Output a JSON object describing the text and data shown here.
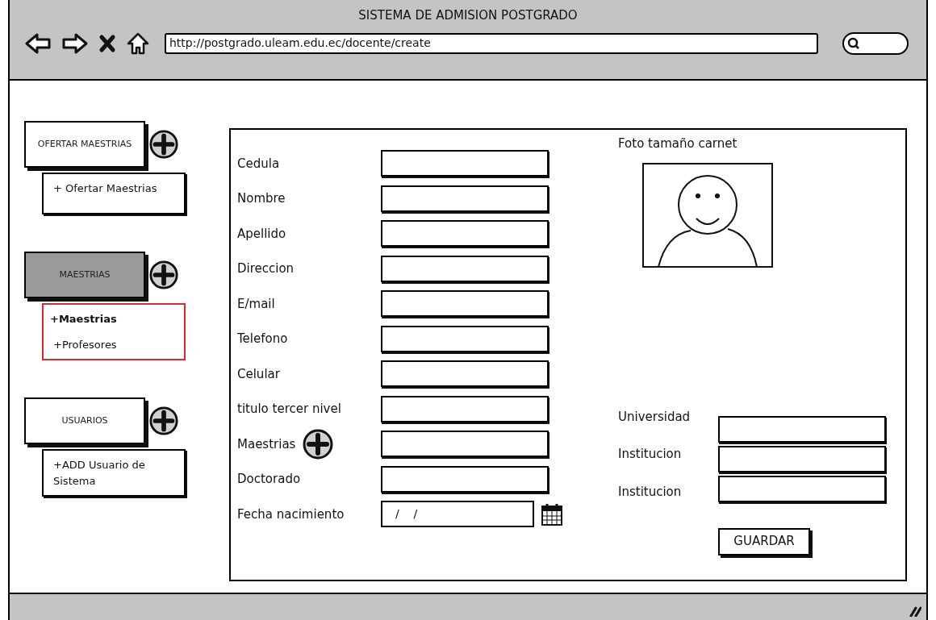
{
  "window": {
    "title": "SISTEMA DE ADMISION POSTGRADO",
    "url": "http://postgrado.uleam.edu.ec/docente/create"
  },
  "sidebar": {
    "sections": [
      {
        "label": "OFERTAR MAESTRIAS",
        "selected": false,
        "highlighted": false,
        "items": [
          {
            "label": "+ Ofertar Maestrias",
            "selected": false
          }
        ]
      },
      {
        "label": "MAESTRIAS",
        "selected": true,
        "highlighted": true,
        "items": [
          {
            "label": "+Maestrias",
            "selected": true
          },
          {
            "label": "+Profesores",
            "selected": false
          }
        ]
      },
      {
        "label": "USUARIOS",
        "selected": false,
        "highlighted": false,
        "items": [
          {
            "label": "+ADD Usuario de Sistema",
            "selected": false
          }
        ]
      }
    ]
  },
  "form": {
    "fields": [
      {
        "label": "Cedula",
        "kind": "text"
      },
      {
        "label": "Nombre",
        "kind": "text"
      },
      {
        "label": "Apellido",
        "kind": "text"
      },
      {
        "label": "Direccion",
        "kind": "text"
      },
      {
        "label": "E/mail",
        "kind": "text"
      },
      {
        "label": "Telefono",
        "kind": "text"
      },
      {
        "label": "Celular",
        "kind": "text"
      },
      {
        "label": "titulo tercer nivel",
        "kind": "text"
      },
      {
        "label": "Maestrias",
        "kind": "add"
      },
      {
        "label": "Doctorado",
        "kind": "text"
      },
      {
        "label": "Fecha nacimiento",
        "kind": "date",
        "value": "/    /"
      }
    ],
    "photo_label": "Foto tamaño carnet",
    "extra_fields": [
      {
        "label": "Universidad"
      },
      {
        "label": "Institucion"
      },
      {
        "label": "Institucion"
      }
    ],
    "save_button": "GUARDAR"
  }
}
